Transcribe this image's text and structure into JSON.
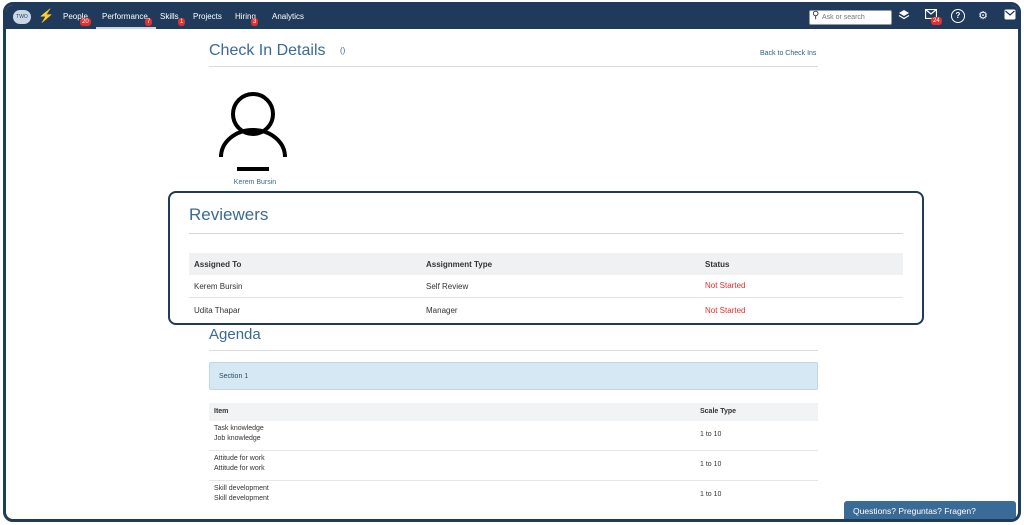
{
  "logo_text": "TWO",
  "nav": {
    "items": [
      {
        "label": "People",
        "badge": "20"
      },
      {
        "label": "Performance",
        "badge": "7"
      },
      {
        "label": "Skills",
        "badge": "1"
      },
      {
        "label": "Projects",
        "badge": ""
      },
      {
        "label": "Hiring",
        "badge": "3"
      },
      {
        "label": "Analytics",
        "badge": ""
      }
    ],
    "active": "Performance"
  },
  "search": {
    "placeholder": "Ask or search"
  },
  "topbar_icons": [
    "layers-icon",
    "mail-icon",
    "help-icon",
    "settings-icon",
    "envelope-icon"
  ],
  "mail_badge": "24",
  "page": {
    "title": "Check In Details",
    "count": "()",
    "back_link": "Back to Check Ins"
  },
  "employee": {
    "name": "Kerem Bursin"
  },
  "reviewers": {
    "title": "Reviewers",
    "headers": [
      "Assigned To",
      "Assignment Type",
      "Status"
    ],
    "rows": [
      {
        "assigned_to": "Kerem Bursin",
        "type": "Self Review",
        "status": "Not Started"
      },
      {
        "assigned_to": "Udita Thapar",
        "type": "Manager",
        "status": "Not Started"
      }
    ]
  },
  "agenda": {
    "title": "Agenda",
    "section": "Section 1",
    "headers": [
      "Item",
      "Scale Type"
    ],
    "rows": [
      {
        "line1": "Task knowledge",
        "line2": "Job knowledge",
        "scale": "1 to 10"
      },
      {
        "line1": "Attitude for work",
        "line2": "Attitude for work",
        "scale": "1 to 10"
      },
      {
        "line1": "Skill development",
        "line2": "Skill development",
        "scale": "1 to 10"
      }
    ]
  },
  "help_widget": {
    "label": "Questions? Preguntas? Fragen?"
  },
  "colors": {
    "navbar": "#1f3a5a",
    "accent": "#3a6a96",
    "status_not_started": "#e2302e",
    "section_bg": "#d5e8f3"
  }
}
